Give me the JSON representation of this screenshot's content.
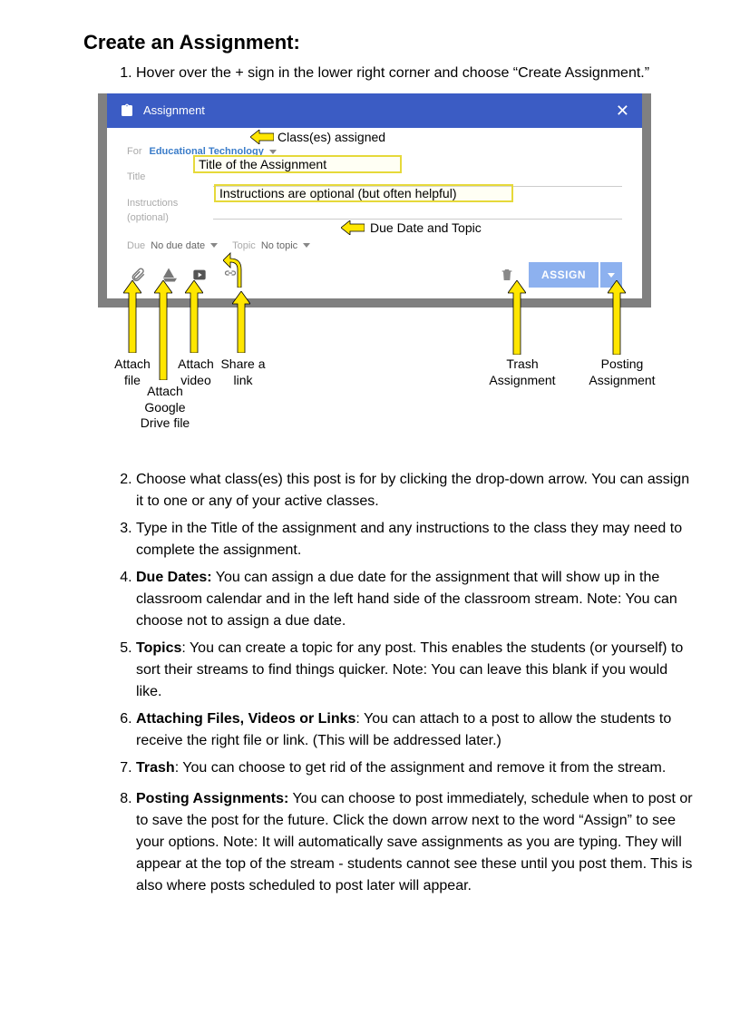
{
  "heading": "Create an Assignment:",
  "step1": "Hover over the + sign in the lower right corner and choose “Create Assignment.”",
  "dialog": {
    "title": "Assignment",
    "for_label": "For",
    "class_name": "Educational Technology",
    "title_label": "Title",
    "instructions_label": "Instructions (optional)",
    "due_label": "Due",
    "due_value": "No due date",
    "topic_label": "Topic",
    "topic_value": "No topic",
    "assign_button": "ASSIGN"
  },
  "callouts": {
    "classes": "Class(es) assigned",
    "title_box": "Title of the Assignment",
    "instructions_box": "Instructions are optional (but often helpful)",
    "due_topic": "Due Date and Topic",
    "attach_file": "Attach file",
    "attach_drive": "Attach Google Drive file",
    "attach_video": "Attach video",
    "share_link": "Share a link",
    "trash": "Trash Assignment",
    "posting": "Posting Assignment"
  },
  "steps": {
    "2": "Choose what class(es) this post is for by clicking the drop-down arrow. You can assign it to one or any of your active classes.",
    "3": "Type in the Title of the assignment and any instructions to the class they may need to complete the assignment.",
    "4_bold": "Due Dates:",
    "4": " You can assign a due date for the assignment that will show up in the classroom calendar and in the left hand side of the classroom stream. Note: You can choose not to assign a due date.",
    "5_bold": "Topics",
    "5": ": You can create a topic for any post. This enables the students (or yourself) to sort their streams to find things quicker. Note: You can leave this blank if you would like.",
    "6_bold": "Attaching Files, Videos or Links",
    "6": ": You can attach to a post to allow the students to receive the right file or link. (This will be addressed later.)",
    "7_bold": "Trash",
    "7": ": You can choose to get rid of the assignment and remove it from the stream.",
    "8_bold": "Posting Assignments:",
    "8": " You can choose to post immediately, schedule when to post or to save the post for the future. Click the down arrow next to the word “Assign” to see your options. Note: It will automatically save assignments as you are typing. They will appear at the top of the stream - students cannot see these until you post them. This is also where posts scheduled to post later will appear."
  }
}
